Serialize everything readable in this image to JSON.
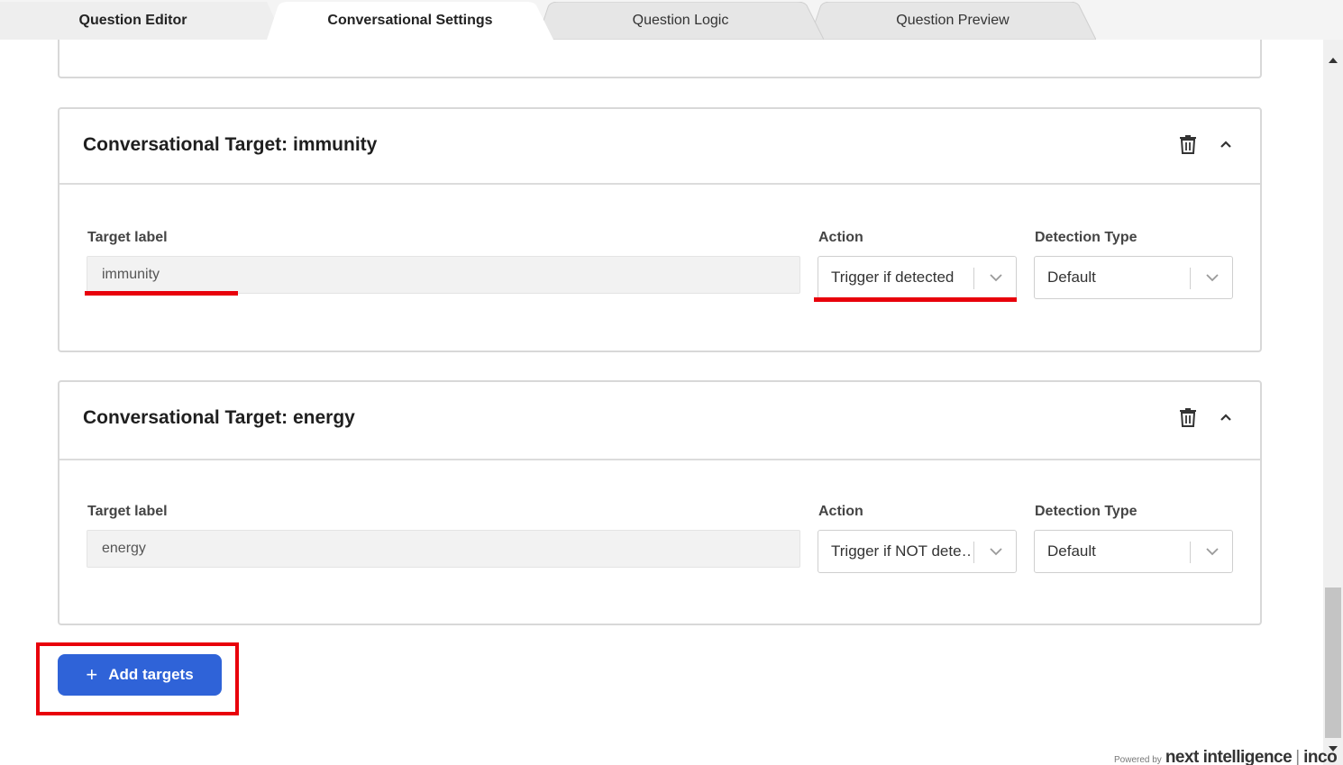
{
  "tabs": [
    {
      "label": "Question Editor",
      "active": false
    },
    {
      "label": "Conversational Settings",
      "active": true
    },
    {
      "label": "Question Logic",
      "active": false
    },
    {
      "label": "Question Preview",
      "active": false
    }
  ],
  "targets": [
    {
      "title": "Conversational Target: immunity",
      "target_label_caption": "Target label",
      "target_label_value": "immunity",
      "action_caption": "Action",
      "action_value": "Trigger if detected",
      "detection_caption": "Detection Type",
      "detection_value": "Default"
    },
    {
      "title": "Conversational Target: energy",
      "target_label_caption": "Target label",
      "target_label_value": "energy",
      "action_caption": "Action",
      "action_value": "Trigger if NOT dete…",
      "detection_caption": "Detection Type",
      "detection_value": "Default"
    }
  ],
  "add_button": {
    "icon": "+",
    "label": "Add targets"
  },
  "footer": {
    "powered": "Powered by",
    "brand": "next intelligence",
    "sep": "|",
    "brand2": "inco"
  },
  "colors": {
    "accent": "#2f63d8",
    "annotation": "#e8000b"
  },
  "icons": [
    "trash-icon",
    "chevron-up-icon",
    "chevron-down-icon",
    "plus-icon"
  ]
}
